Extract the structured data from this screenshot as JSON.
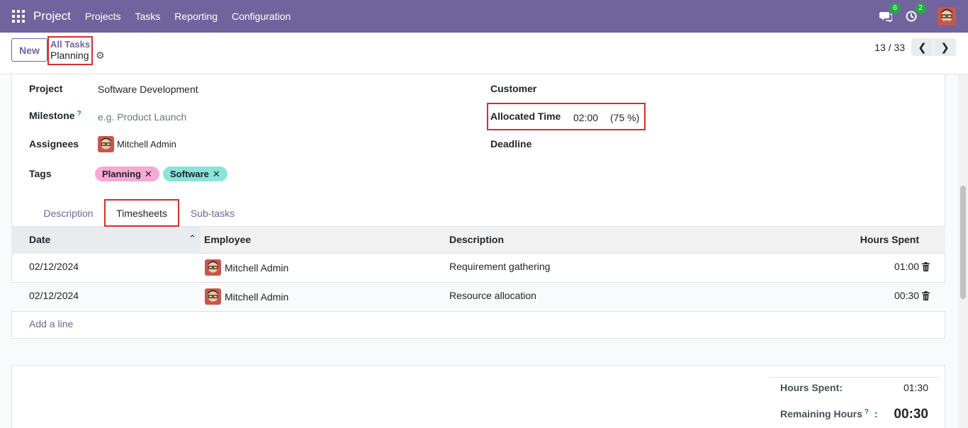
{
  "navbar": {
    "app_name": "Project",
    "menu": [
      "Projects",
      "Tasks",
      "Reporting",
      "Configuration"
    ],
    "messages_count": "6",
    "activities_count": "2",
    "brand_color": "#71639e"
  },
  "control": {
    "new_label": "New",
    "breadcrumb_parent": "All Tasks",
    "breadcrumb_current": "Planning",
    "pager": "13 / 33"
  },
  "form": {
    "project_label": "Project",
    "project_value": "Software Development",
    "milestone_label": "Milestone",
    "milestone_help": "?",
    "milestone_placeholder": "e.g. Product Launch",
    "assignees_label": "Assignees",
    "assignee_name": "Mitchell Admin",
    "tags_label": "Tags",
    "tags": [
      {
        "label": "Planning",
        "color": "#f7a8d3"
      },
      {
        "label": "Software",
        "color": "#8ae3d9"
      }
    ],
    "customer_label": "Customer",
    "allocated_label": "Allocated Time",
    "allocated_value": "02:00",
    "allocated_percent": "(75 %)",
    "deadline_label": "Deadline"
  },
  "tabs": [
    "Description",
    "Timesheets",
    "Sub-tasks"
  ],
  "timesheets": {
    "columns": [
      "Date",
      "Employee",
      "Description",
      "Hours Spent"
    ],
    "rows": [
      {
        "date": "02/12/2024",
        "employee": "Mitchell Admin",
        "description": "Requirement gathering",
        "hours": "01:00"
      },
      {
        "date": "02/12/2024",
        "employee": "Mitchell Admin",
        "description": "Resource allocation",
        "hours": "00:30"
      }
    ],
    "add_line": "Add a line"
  },
  "totals": {
    "hours_spent_label": "Hours Spent:",
    "hours_spent_value": "01:30",
    "remaining_label": "Remaining Hours",
    "remaining_help": "?",
    "remaining_colon": ":",
    "remaining_value": "00:30"
  }
}
